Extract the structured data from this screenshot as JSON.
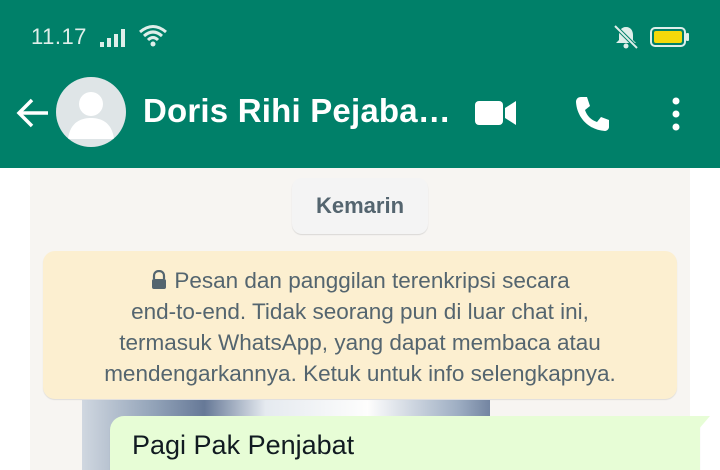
{
  "status_bar": {
    "time": "11.17",
    "icons": [
      "signal-icon",
      "wifi-icon",
      "mute-icon",
      "battery-icon"
    ]
  },
  "header": {
    "contact_name": "Doris Rihi Pejaba…",
    "icons": [
      "back-icon",
      "avatar",
      "video-call-icon",
      "voice-call-icon",
      "menu-icon"
    ],
    "background_color": "#008069"
  },
  "chat": {
    "date_chip": "Kemarin",
    "encryption_notice": {
      "lines": [
        "Pesan dan panggilan terenkripsi secara",
        "end-to-end. Tidak seorang pun di luar chat ini,",
        "termasuk WhatsApp, yang dapat membaca atau",
        "mendengarkannya. Ketuk untuk info selengkapnya."
      ],
      "icon": "lock-icon",
      "background_color": "#fcefd0"
    },
    "messages": [
      {
        "direction": "outgoing",
        "text": "Pagi Pak Penjabat"
      }
    ],
    "outgoing_bubble_color": "#e7fdd6"
  }
}
